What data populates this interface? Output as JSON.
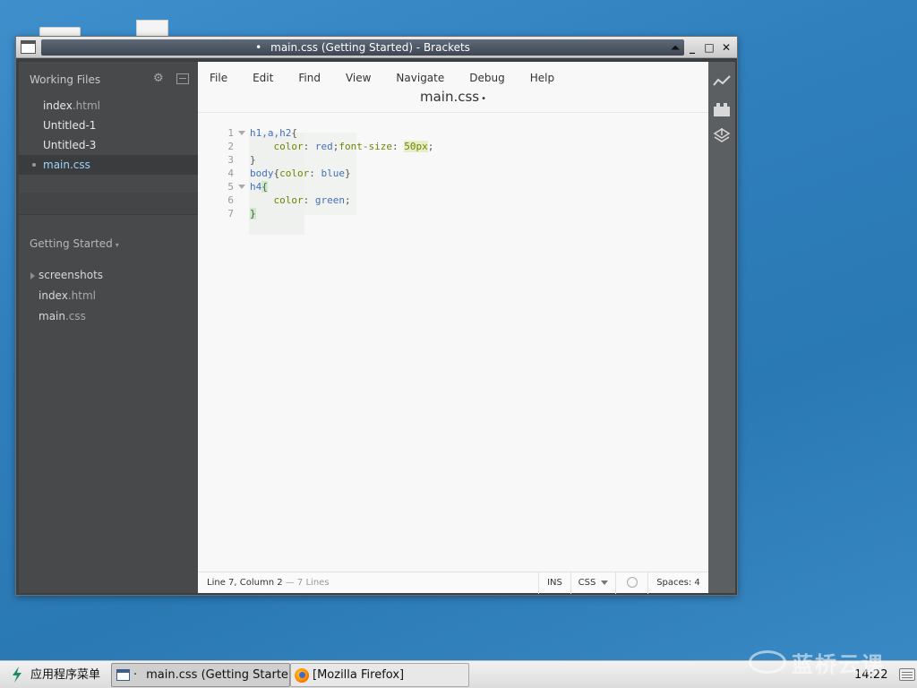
{
  "window": {
    "title_dot": "•",
    "title": "main.css (Getting Started) - Brackets",
    "btn_up": "⏶",
    "btn_min": "_",
    "btn_max": "□",
    "btn_close": "✕"
  },
  "sidebar": {
    "working_files_label": "Working Files",
    "working_files": [
      {
        "name": "index",
        "ext": ".html"
      },
      {
        "name": "Untitled-1",
        "ext": ""
      },
      {
        "name": "Untitled-3",
        "ext": ""
      },
      {
        "name": "main",
        "ext": ".css"
      }
    ],
    "project_label": "Getting Started",
    "project_caret": "▾",
    "project_items": [
      {
        "name": "screenshots",
        "ext": ""
      },
      {
        "name": "index",
        "ext": ".html"
      },
      {
        "name": "main",
        "ext": ".css"
      }
    ]
  },
  "menu": {
    "items": [
      "File",
      "Edit",
      "Find",
      "View",
      "Navigate",
      "Debug",
      "Help"
    ]
  },
  "editor": {
    "file_title": "main.css",
    "dirty_dot": "•",
    "line_numbers": [
      "1",
      "2",
      "3",
      "4",
      "5",
      "6",
      "7"
    ],
    "lines": [
      [
        {
          "t": "h1,a,h2",
          "c": "sel"
        },
        {
          "t": "{",
          "c": "pun"
        }
      ],
      [
        {
          "t": "    ",
          "c": "pun"
        },
        {
          "t": "color",
          "c": "prop"
        },
        {
          "t": ": ",
          "c": "pun"
        },
        {
          "t": "red",
          "c": "val"
        },
        {
          "t": ";",
          "c": "pun"
        },
        {
          "t": "font-size",
          "c": "prop"
        },
        {
          "t": ": ",
          "c": "pun"
        },
        {
          "t": "50px",
          "c": "num"
        },
        {
          "t": ";",
          "c": "pun"
        }
      ],
      [
        {
          "t": "}",
          "c": "pun"
        }
      ],
      [
        {
          "t": "body",
          "c": "sel"
        },
        {
          "t": "{",
          "c": "pun"
        },
        {
          "t": "color",
          "c": "prop"
        },
        {
          "t": ": ",
          "c": "pun"
        },
        {
          "t": "blue",
          "c": "val"
        },
        {
          "t": "}",
          "c": "pun"
        }
      ],
      [
        {
          "t": "h4",
          "c": "sel"
        },
        {
          "t": "{",
          "c": "brace-match"
        }
      ],
      [
        {
          "t": "    ",
          "c": "pun"
        },
        {
          "t": "color",
          "c": "prop"
        },
        {
          "t": ": ",
          "c": "pun"
        },
        {
          "t": "green",
          "c": "val"
        },
        {
          "t": ";",
          "c": "pun"
        }
      ],
      [
        {
          "t": "}",
          "c": "brace-match"
        }
      ]
    ]
  },
  "status": {
    "position": "Line 7, Column 2",
    "lines": " — 7 Lines",
    "mode": "INS",
    "language": "CSS",
    "spaces": "Spaces:  4"
  },
  "taskbar": {
    "start_label": "应用程序菜单",
    "task1_dot": "·",
    "task1_label": "main.css (Getting Starte…",
    "task2_label": "[Mozilla Firefox]",
    "watermark": "蓝桥云课",
    "clock": "14:22"
  }
}
